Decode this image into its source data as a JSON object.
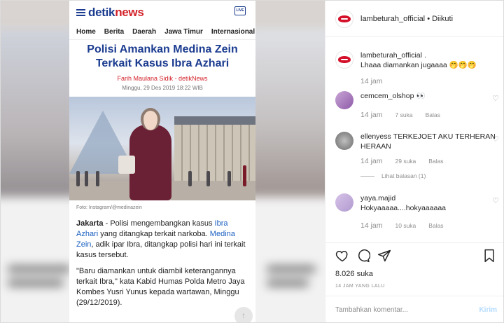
{
  "article": {
    "brand_detik": "detik",
    "brand_news": "news",
    "live_badge": "LIVE",
    "nav": [
      "Home",
      "Berita",
      "Daerah",
      "Jawa Timur",
      "Internasional"
    ],
    "headline": "Polisi Amankan Medina Zein Terkait Kasus Ibra Azhari",
    "author": "Farih Maulana Sidik - detikNews",
    "date": "Minggu, 29 Des 2019 18:22 WIB",
    "photo_caption": "Foto: Instagram/@medinazein",
    "p1_city": "Jakarta",
    "p1_a": " - Polisi mengembangkan kasus ",
    "p1_link1": "Ibra Azhari",
    "p1_b": " yang ditangkap terkait narkoba. ",
    "p1_link2": "Medina Zein",
    "p1_c": ", adik ipar Ibra, ditangkap polisi hari ini terkait kasus tersebut.",
    "p2": "\"Baru diamankan untuk diambil keterangannya terkait Ibra,\" kata Kabid Humas Polda Metro Jaya Kombes Yusri Yunus kepada wartawan, Minggu (29/12/2019).",
    "scroll_top": "↑"
  },
  "post": {
    "username": "lambeturah_official",
    "follow_status": " • Diikuti"
  },
  "comments": [
    {
      "user": "lambeturah_official",
      "text": ".",
      "text2": "Lhaaa diamankan jugaaaa 🤭🤭🤭",
      "time": "14 jam",
      "likes": "",
      "reply": ""
    },
    {
      "user": "cemcem_olshop",
      "text": "👀",
      "time": "14 jam",
      "likes": "7 suka",
      "reply": "Balas"
    },
    {
      "user": "ellenyess",
      "text": "TERKEJOET AKU TERHERAN HERAAN",
      "time": "14 jam",
      "likes": "29 suka",
      "reply": "Balas",
      "view_replies": "Lihat balasan (1)"
    },
    {
      "user": "yaya.majid",
      "text": "Hokyaaaaa....hokyaaaaaa",
      "time": "14 jam",
      "likes": "10 suka",
      "reply": "Balas"
    }
  ],
  "stats": {
    "likes": "8.026 suka",
    "time_ago": "14 JAM YANG LALU"
  },
  "add_comment": {
    "placeholder": "Tambahkan komentar...",
    "send_label": "Kirim"
  },
  "icons": {
    "like": "heart-icon",
    "comment": "speech-bubble-icon",
    "share": "paper-plane-icon",
    "save": "bookmark-icon"
  }
}
